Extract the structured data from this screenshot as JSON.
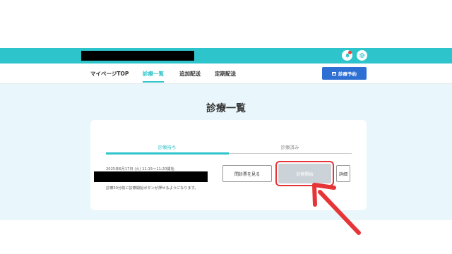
{
  "header": {
    "bell_icon": "bell-icon",
    "settings_icon": "gear-icon",
    "bar_color": "#2ec4cc"
  },
  "nav": {
    "items": [
      {
        "label": "マイページTOP"
      },
      {
        "label": "診療一覧",
        "active": true
      },
      {
        "label": "追加配送"
      },
      {
        "label": "定期配送"
      }
    ],
    "reserve_button": "診療予約"
  },
  "main": {
    "title": "診療一覧",
    "tabs": [
      {
        "label": "診療待ち",
        "active": true
      },
      {
        "label": "診療済み"
      }
    ],
    "appointment": {
      "datetime": "2025年6月17日 (火) 11:15～11:20開始",
      "note": "診療30分前に診療開始ボタンが押せるようになります。",
      "questionnaire_button": "問診票を見る",
      "start_button": "診療開始",
      "detail_button": "詳細"
    }
  },
  "colors": {
    "accent": "#2ec4cc",
    "primary_button": "#2d6fd3",
    "annotation": "#e63538",
    "disabled_button": "#ccd3d8"
  }
}
